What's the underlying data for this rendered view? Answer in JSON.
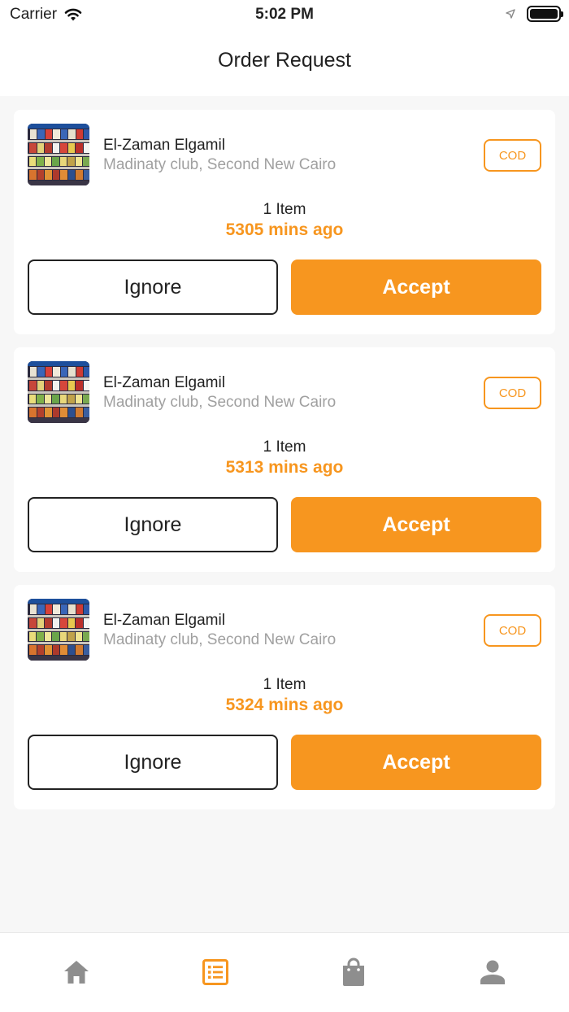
{
  "status_bar": {
    "carrier": "Carrier",
    "time": "5:02 PM"
  },
  "header": {
    "title": "Order Request"
  },
  "orders": [
    {
      "store_name": "El-Zaman Elgamil",
      "address": "Madinaty club, Second New Cairo",
      "payment_method": "COD",
      "item_count": "1 Item",
      "time_ago": "5305 mins ago",
      "ignore_label": "Ignore",
      "accept_label": "Accept"
    },
    {
      "store_name": "El-Zaman Elgamil",
      "address": "Madinaty club, Second New Cairo",
      "payment_method": "COD",
      "item_count": "1 Item",
      "time_ago": "5313 mins ago",
      "ignore_label": "Ignore",
      "accept_label": "Accept"
    },
    {
      "store_name": "El-Zaman Elgamil",
      "address": "Madinaty club, Second New Cairo",
      "payment_method": "COD",
      "item_count": "1 Item",
      "time_ago": "5324 mins ago",
      "ignore_label": "Ignore",
      "accept_label": "Accept"
    }
  ],
  "tab_bar": {
    "active_tab": "orders",
    "tabs": [
      {
        "icon": "home-icon"
      },
      {
        "icon": "order-list-icon"
      },
      {
        "icon": "shopping-bag-icon"
      },
      {
        "icon": "profile-icon"
      }
    ]
  },
  "colors": {
    "accent": "#f7961f",
    "inactive_icon": "#8e8e8e",
    "background": "#f7f7f7"
  }
}
